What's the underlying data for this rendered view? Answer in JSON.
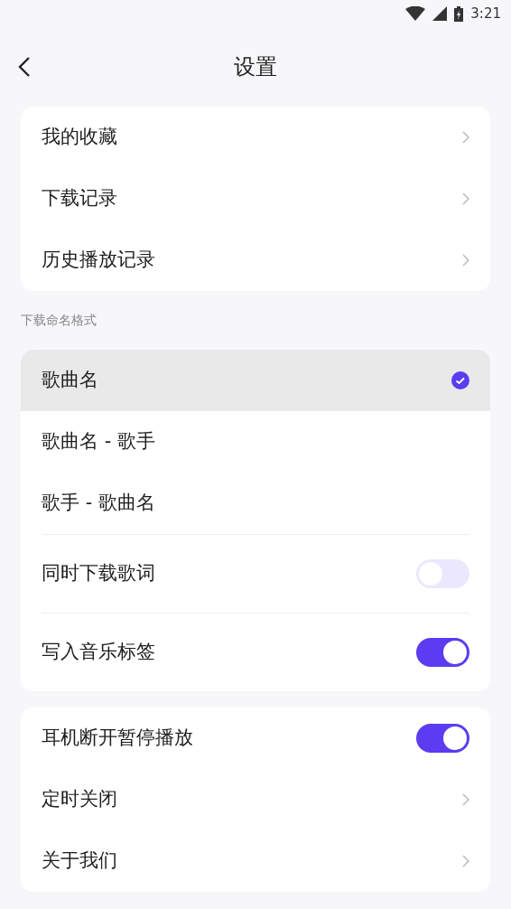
{
  "status_bar": {
    "time": "3:21"
  },
  "header": {
    "title": "设置"
  },
  "groups": [
    {
      "items": [
        {
          "kind": "link",
          "label": "我的收藏"
        },
        {
          "kind": "link",
          "label": "下载记录"
        },
        {
          "kind": "link",
          "label": "历史播放记录"
        }
      ]
    },
    {
      "section_label": "下载命名格式",
      "items": [
        {
          "kind": "option",
          "label": "歌曲名",
          "selected": true
        },
        {
          "kind": "option",
          "label": "歌曲名 - 歌手",
          "selected": false
        },
        {
          "kind": "option",
          "label": "歌手 - 歌曲名",
          "selected": false
        },
        {
          "kind": "toggle",
          "label": "同时下载歌词",
          "on": false
        },
        {
          "kind": "toggle",
          "label": "写入音乐标签",
          "on": true
        }
      ]
    },
    {
      "items": [
        {
          "kind": "toggle",
          "label": "耳机断开暂停播放",
          "on": true
        },
        {
          "kind": "link",
          "label": "定时关闭"
        },
        {
          "kind": "link",
          "label": "关于我们"
        }
      ]
    }
  ]
}
